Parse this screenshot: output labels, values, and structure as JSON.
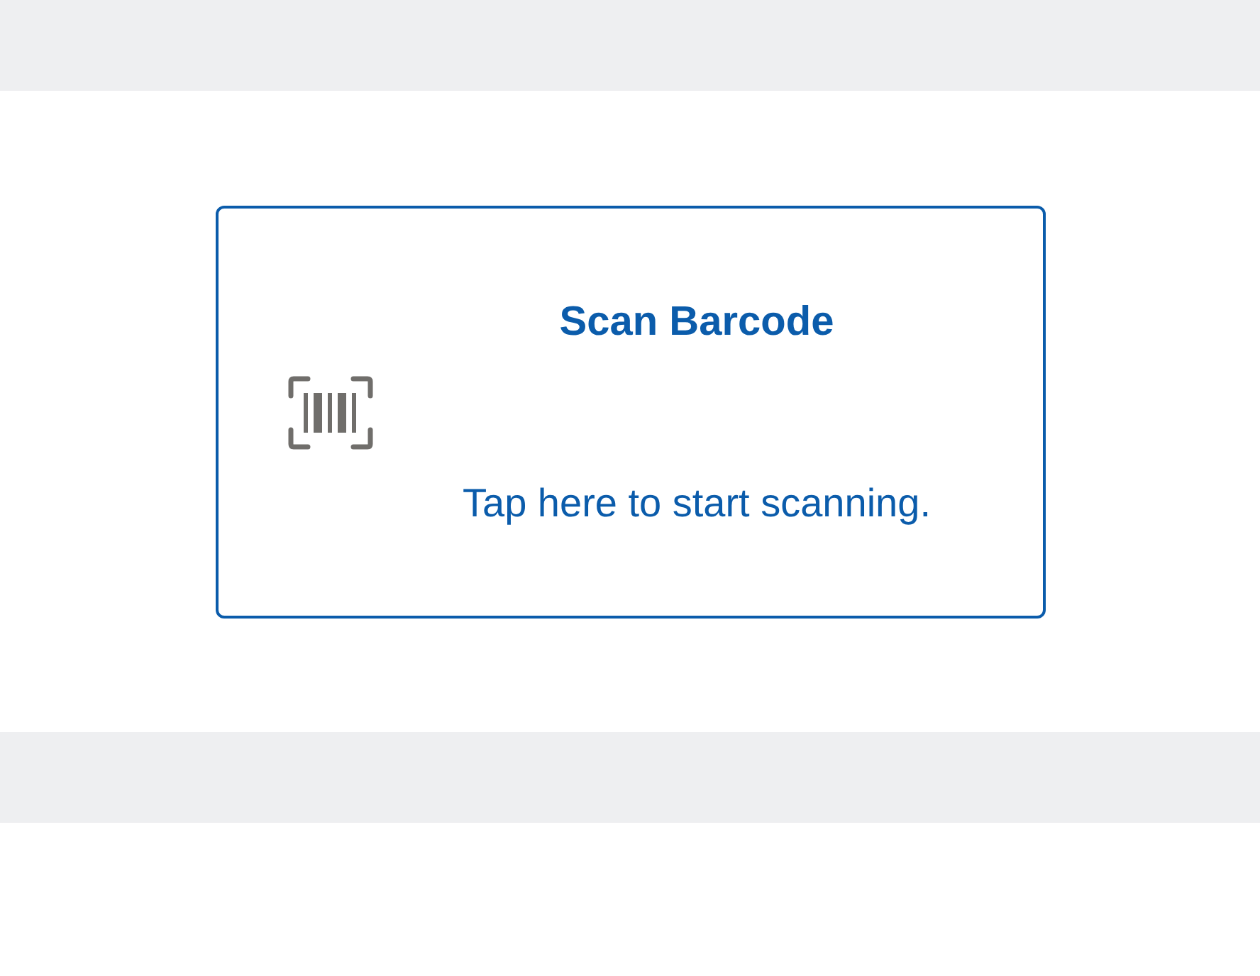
{
  "scan_card": {
    "title": "Scan Barcode",
    "prompt": "Tap here to start scanning."
  }
}
